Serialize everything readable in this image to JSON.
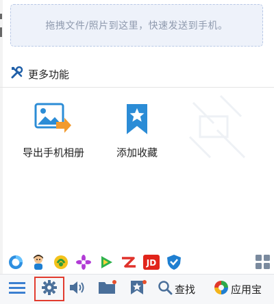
{
  "drop_zone": {
    "text": "拖拽文件/照片到这里，快速发送到手机。"
  },
  "more_functions": {
    "title": "更多功能"
  },
  "features": [
    {
      "label": "导出手机相册"
    },
    {
      "label": "添加收藏"
    }
  ],
  "bottom_bar": {
    "search_label": "查找",
    "app_store_label": "应用宝"
  },
  "apps_row": {
    "jd_label": "JD"
  },
  "colors": {
    "accent_blue": "#2b8cd6",
    "highlight_red": "#e23b2e",
    "export_orange": "#f29a2e"
  }
}
